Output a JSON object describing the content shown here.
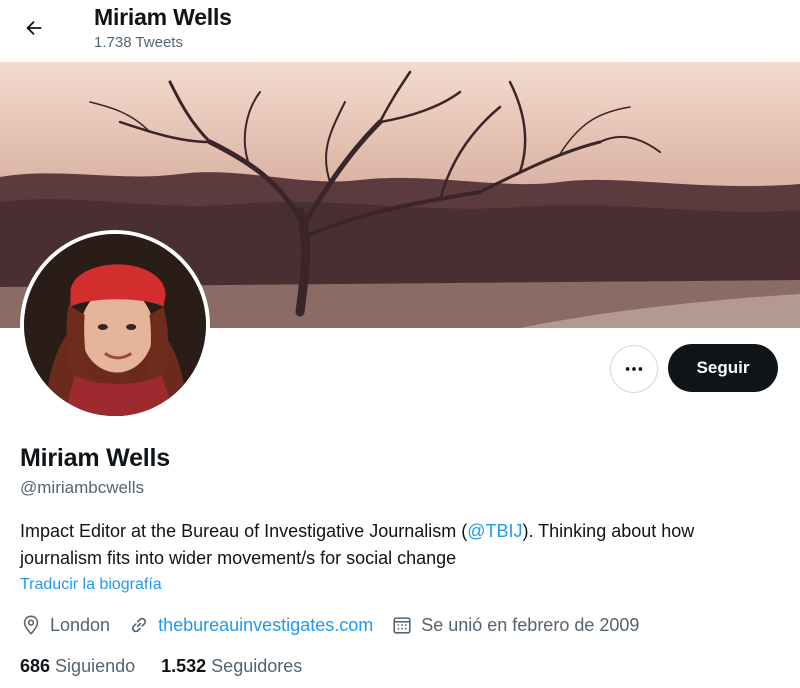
{
  "header": {
    "name": "Miriam Wells",
    "tweet_count": "1.738 Tweets"
  },
  "profile": {
    "display_name": "Miriam Wells",
    "handle": "@miriambcwells",
    "bio_before": "Impact Editor at the Bureau of Investigative Journalism (",
    "bio_mention": "@TBIJ",
    "bio_after": "). Thinking about how journalism fits into wider movement/s for social change",
    "translate_label": "Traducir la biografía",
    "location": "London",
    "website": "thebureauinvestigates.com",
    "joined": "Se unió en febrero de 2009",
    "following_count": "686",
    "following_label": "Siguiendo",
    "followers_count": "1.532",
    "followers_label": "Seguidores"
  },
  "actions": {
    "follow_label": "Seguir"
  },
  "icons": {
    "back": "arrow-left-icon",
    "more": "more-dots-icon",
    "location": "location-pin-icon",
    "link": "link-icon",
    "calendar": "calendar-icon"
  },
  "colors": {
    "accent": "#1d9bf0",
    "primary_text": "#0f1419",
    "secondary_text": "#536471",
    "follow_button": "#0f1419"
  }
}
